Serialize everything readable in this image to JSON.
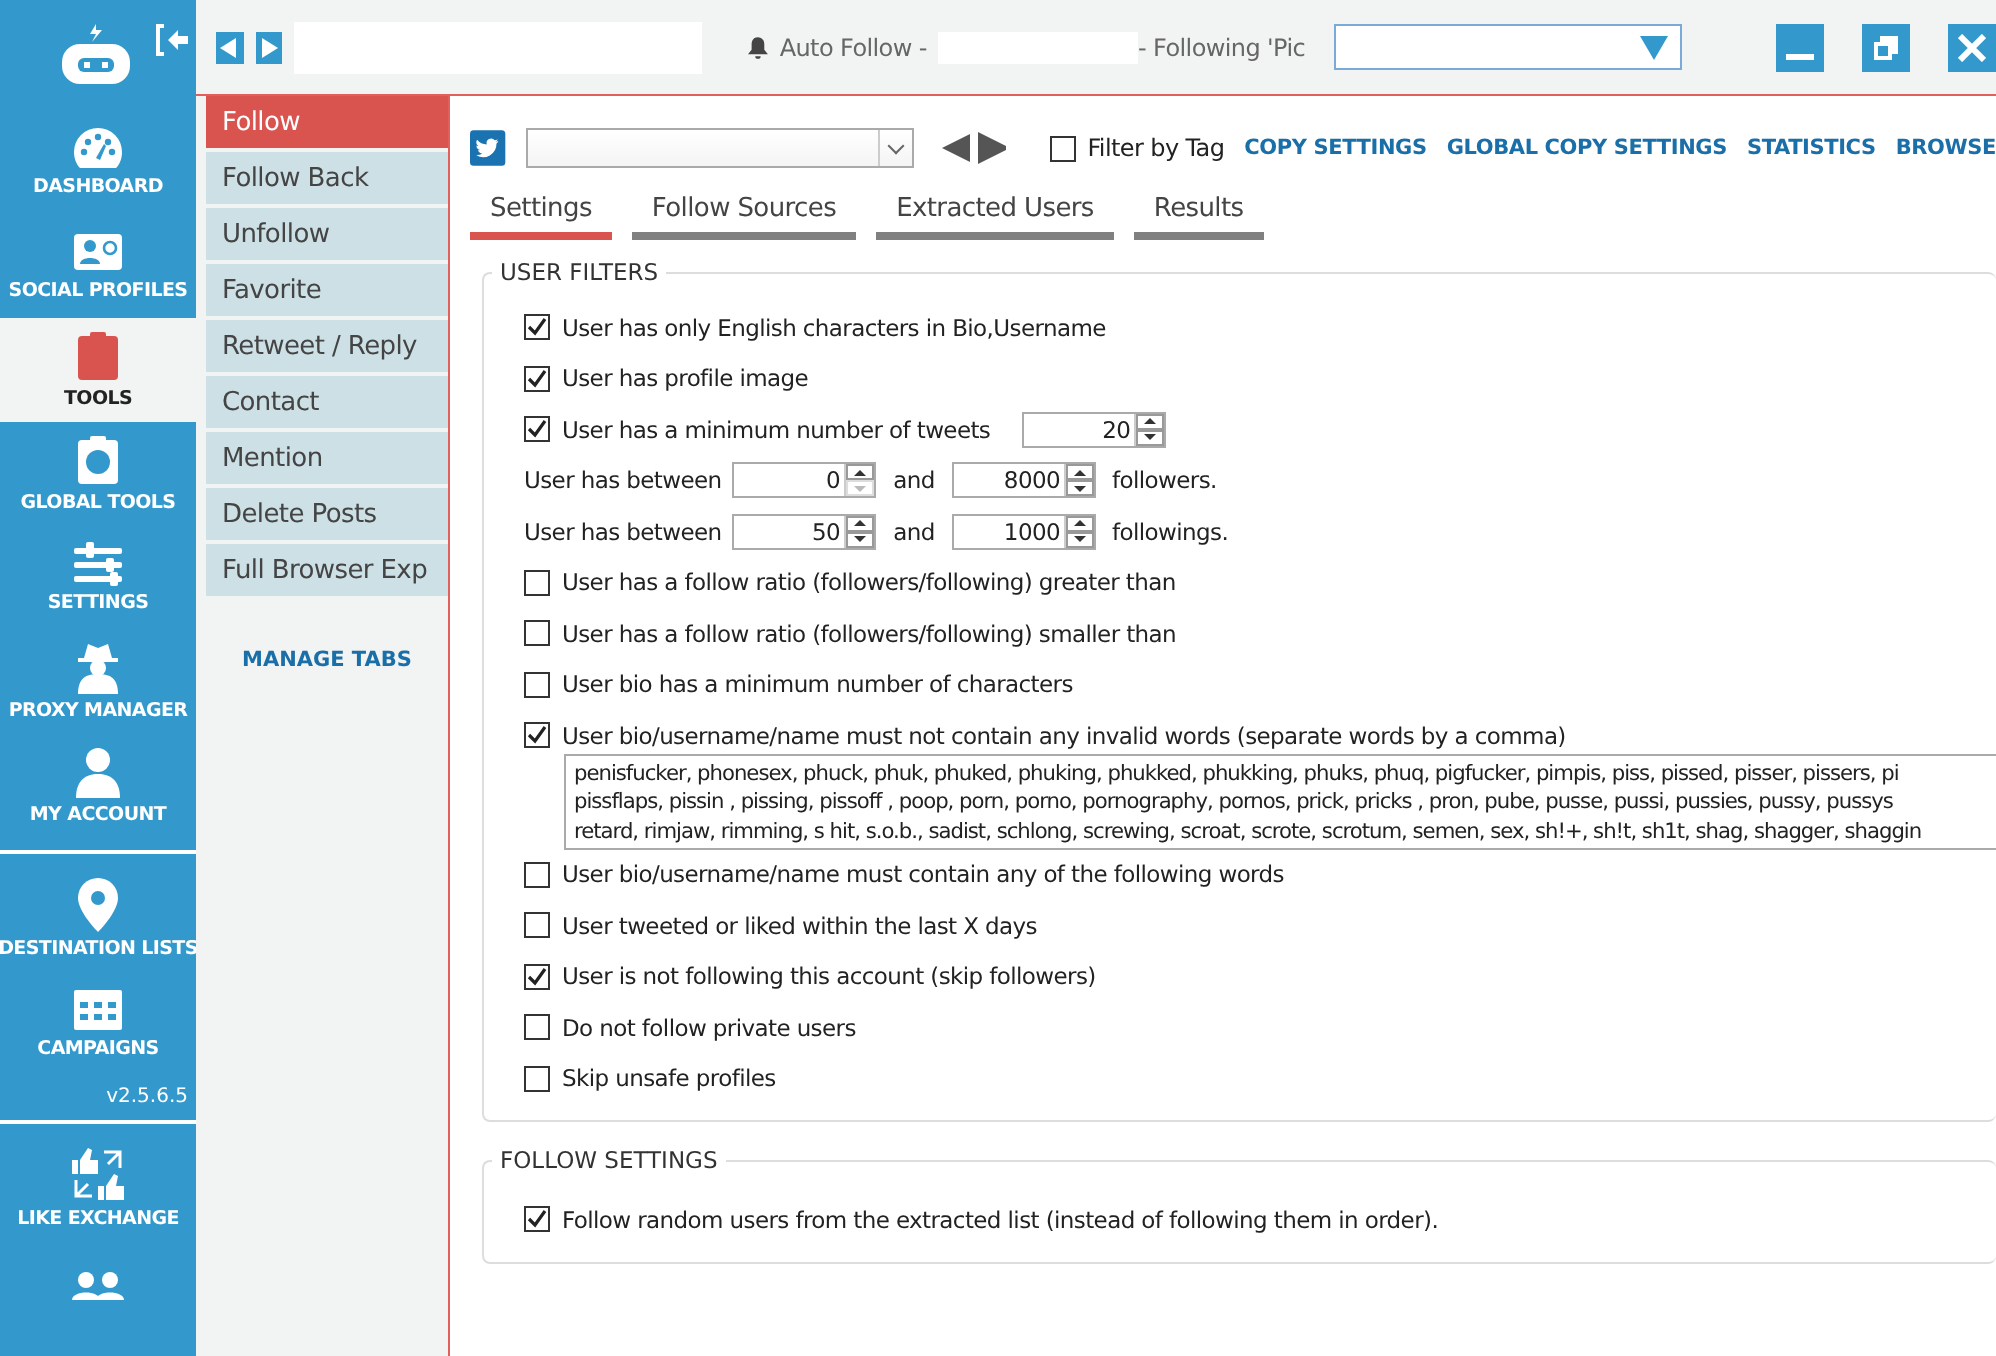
{
  "sidebar": {
    "groups": [
      {
        "items": [
          {
            "label": "DASHBOARD",
            "selected": false
          },
          {
            "label": "SOCIAL PROFILES",
            "selected": false
          },
          {
            "label": "TOOLS",
            "selected": true
          },
          {
            "label": "GLOBAL TOOLS",
            "selected": false
          },
          {
            "label": "SETTINGS",
            "selected": false
          },
          {
            "label": "PROXY MANAGER",
            "selected": false
          },
          {
            "label": "MY ACCOUNT",
            "selected": false
          }
        ]
      },
      {
        "items": [
          {
            "label": "DESTINATION LISTS",
            "selected": false
          },
          {
            "label": "CAMPAIGNS",
            "selected": false
          }
        ],
        "version": "v2.5.6.5"
      },
      {
        "items": [
          {
            "label": "LIKE EXCHANGE",
            "selected": false
          },
          {
            "selected": false
          }
        ]
      }
    ]
  },
  "titlebar": {
    "module": "Auto Follow -",
    "following": "- Following 'Pic"
  },
  "subtabs": {
    "items": [
      {
        "label": "Follow",
        "selected": true
      },
      {
        "label": "Follow Back",
        "selected": false
      },
      {
        "label": "Unfollow",
        "selected": false
      },
      {
        "label": "Favorite",
        "selected": false
      },
      {
        "label": "Retweet / Reply",
        "selected": false
      },
      {
        "label": "Contact",
        "selected": false
      },
      {
        "label": "Mention",
        "selected": false
      },
      {
        "label": "Delete Posts",
        "selected": false
      },
      {
        "label": "Full Browser Exp",
        "selected": false
      }
    ],
    "manage": "MANAGE TABS"
  },
  "toolbar": {
    "filter_by_tag": {
      "label": "Filter by Tag",
      "checked": false
    },
    "links": [
      "COPY SETTINGS",
      "GLOBAL COPY SETTINGS",
      "STATISTICS",
      "BROWSE"
    ]
  },
  "tabs": [
    {
      "label": "Settings",
      "selected": true
    },
    {
      "label": "Follow Sources",
      "selected": false
    },
    {
      "label": "Extracted Users",
      "selected": false
    },
    {
      "label": "Results",
      "selected": false
    }
  ],
  "user_filters": {
    "title": "USER FILTERS",
    "rows": [
      {
        "kind": "check",
        "label": "User has only English characters in Bio,Username",
        "checked": true
      },
      {
        "kind": "check",
        "label": "User has profile image",
        "checked": true
      },
      {
        "kind": "check",
        "label": "User has a minimum number of tweets",
        "checked": true,
        "value": "20"
      },
      {
        "kind": "range",
        "label": "User has between",
        "from": "0",
        "from_at_min": true,
        "and": "and",
        "to": "8000",
        "unit": "followers."
      },
      {
        "kind": "range",
        "label": "User has between",
        "from": "50",
        "from_at_min": false,
        "and": "and",
        "to": "1000",
        "unit": "followings."
      },
      {
        "kind": "check",
        "label": "User has a follow ratio (followers/following) greater than",
        "checked": false
      },
      {
        "kind": "check",
        "label": "User has a follow ratio (followers/following) smaller than",
        "checked": false
      },
      {
        "kind": "check",
        "label": "User bio has a minimum number of characters",
        "checked": false
      },
      {
        "kind": "words",
        "label": "User bio/username/name must not contain any invalid words (separate words by a comma)",
        "checked": true,
        "lines": [
          "penisfucker, phonesex, phuck, phuk, phuked, phuking, phukked, phukking, phuks, phuq, pigfucker, pimpis, piss, pissed, pisser, pissers, pi",
          "pissflaps, pissin , pissing, pissoff , poop, porn, porno, pornography, pornos, prick, pricks , pron, pube, pusse, pussi, pussies, pussy, pussys",
          "retard, rimjaw, rimming, s hit, s.o.b., sadist, schlong, screwing, scroat, scrote, scrotum, semen, sex, sh!+, sh!t, sh1t, shag, shagger, shaggin"
        ]
      },
      {
        "kind": "check",
        "label": "User bio/username/name must contain any of the following words",
        "checked": false
      },
      {
        "kind": "check",
        "label": "User tweeted or liked within the last X days",
        "checked": false
      },
      {
        "kind": "check",
        "label": "User is not following this account (skip followers)",
        "checked": true
      },
      {
        "kind": "check",
        "label": "Do not follow private users",
        "checked": false
      },
      {
        "kind": "check",
        "label": "Skip unsafe profiles",
        "checked": false
      }
    ]
  },
  "follow_settings": {
    "title": "FOLLOW SETTINGS",
    "rows": [
      {
        "kind": "check",
        "label": "Follow random users from the extracted list (instead of following them in order).",
        "checked": true
      }
    ]
  }
}
